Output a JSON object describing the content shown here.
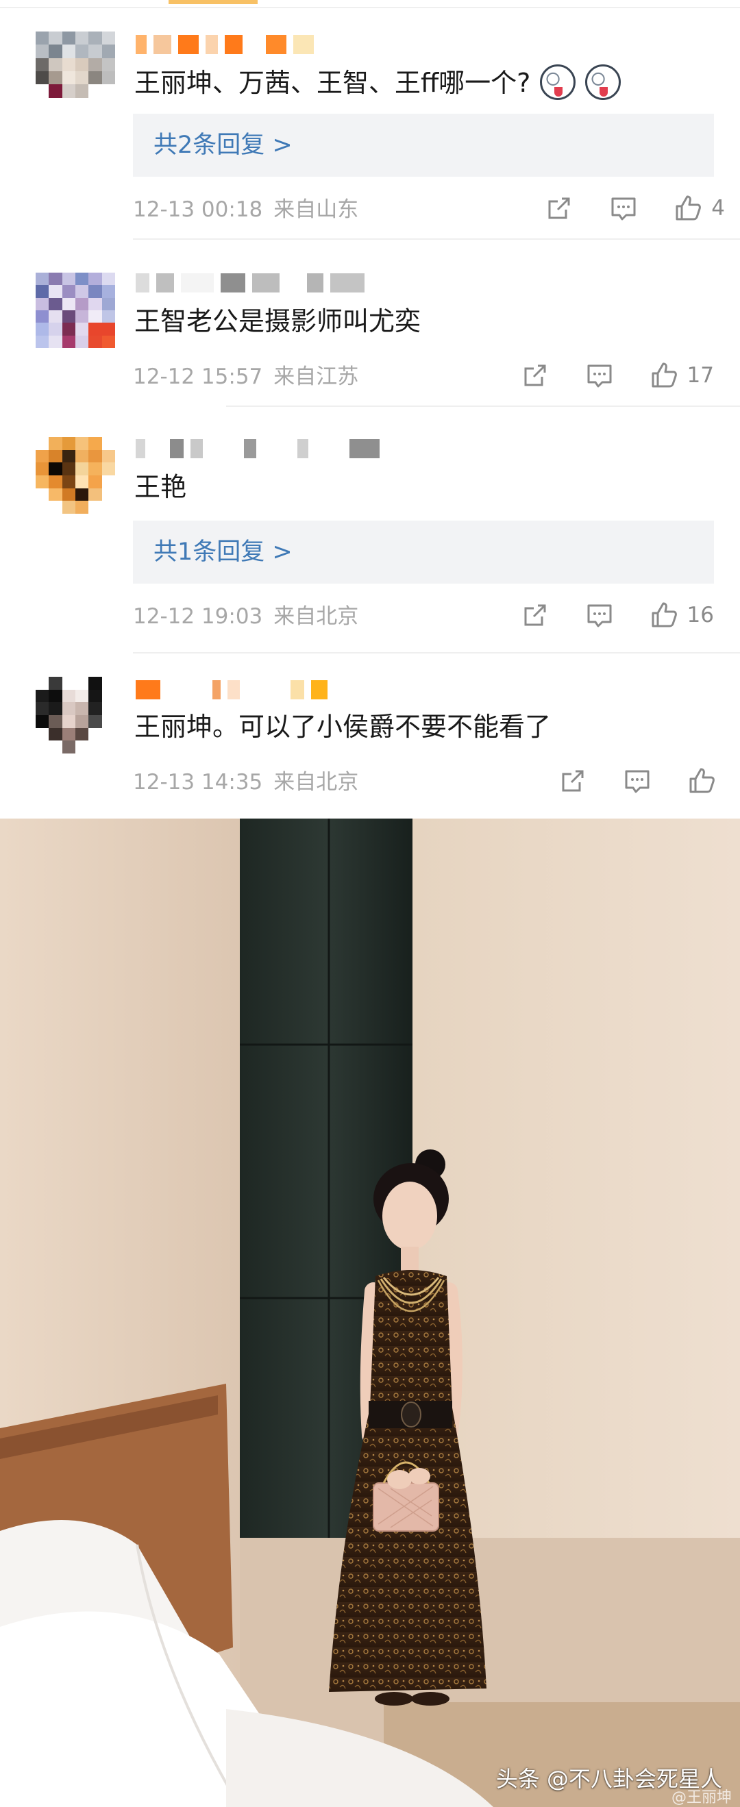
{
  "comments": [
    {
      "text": "王丽坤、万茜、王智、王ff哪一个?",
      "emoji": "dog-tongue-emoji",
      "reply_label": "共2条回复 >",
      "time": "12-13 00:18",
      "location": "来自山东",
      "likes": "4"
    },
    {
      "text": "王智老公是摄影师叫尤奕",
      "time": "12-12 15:57",
      "location": "来自江苏",
      "likes": "17"
    },
    {
      "text": "王艳",
      "reply_label": "共1条回复 >",
      "time": "12-12 19:03",
      "location": "来自北京",
      "likes": "16"
    },
    {
      "text": "王丽坤。可以了小侯爵不要不能看了",
      "time": "12-13 14:35",
      "location": "来自北京",
      "likes": ""
    }
  ],
  "watermark": {
    "main": "头条 @不八卦会死星人",
    "sub": "@王丽坤"
  },
  "colors": {
    "link_blue": "#3f79b6",
    "meta_gray": "#a7a7a7",
    "reply_bg": "#f2f3f5"
  },
  "icons": [
    "share-icon",
    "comment-icon",
    "like-icon"
  ]
}
